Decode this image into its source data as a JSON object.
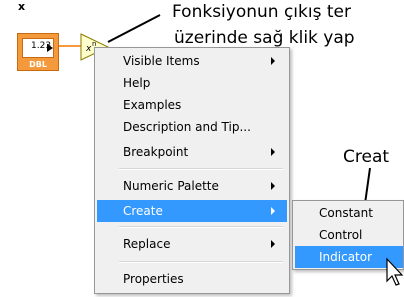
{
  "diagram": {
    "x_label": "x",
    "control_value": "1.23",
    "control_type": "DBL",
    "function_icon": "x-to-the-n-icon"
  },
  "callouts": {
    "line1": "Fonksiyonun çıkış ter",
    "line2": "üzerinde sağ klik yap",
    "line3": "Creat"
  },
  "menu": {
    "items": [
      {
        "label": "Visible Items",
        "submenu": true
      },
      {
        "label": "Help",
        "submenu": false
      },
      {
        "label": "Examples",
        "submenu": false
      },
      {
        "label": "Description and Tip...",
        "submenu": false
      },
      {
        "label": "Breakpoint",
        "submenu": true
      },
      {
        "label": "Numeric Palette",
        "submenu": true
      },
      {
        "label": "Create",
        "submenu": true,
        "selected": true
      },
      {
        "label": "Replace",
        "submenu": true
      },
      {
        "label": "Properties",
        "submenu": false
      }
    ]
  },
  "submenu": {
    "items": [
      {
        "label": "Constant"
      },
      {
        "label": "Control"
      },
      {
        "label": "Indicator",
        "selected": true
      }
    ]
  },
  "colors": {
    "accent": "#3399ff",
    "control_orange": "#f59a3c",
    "menu_bg": "#f0f0f0"
  }
}
